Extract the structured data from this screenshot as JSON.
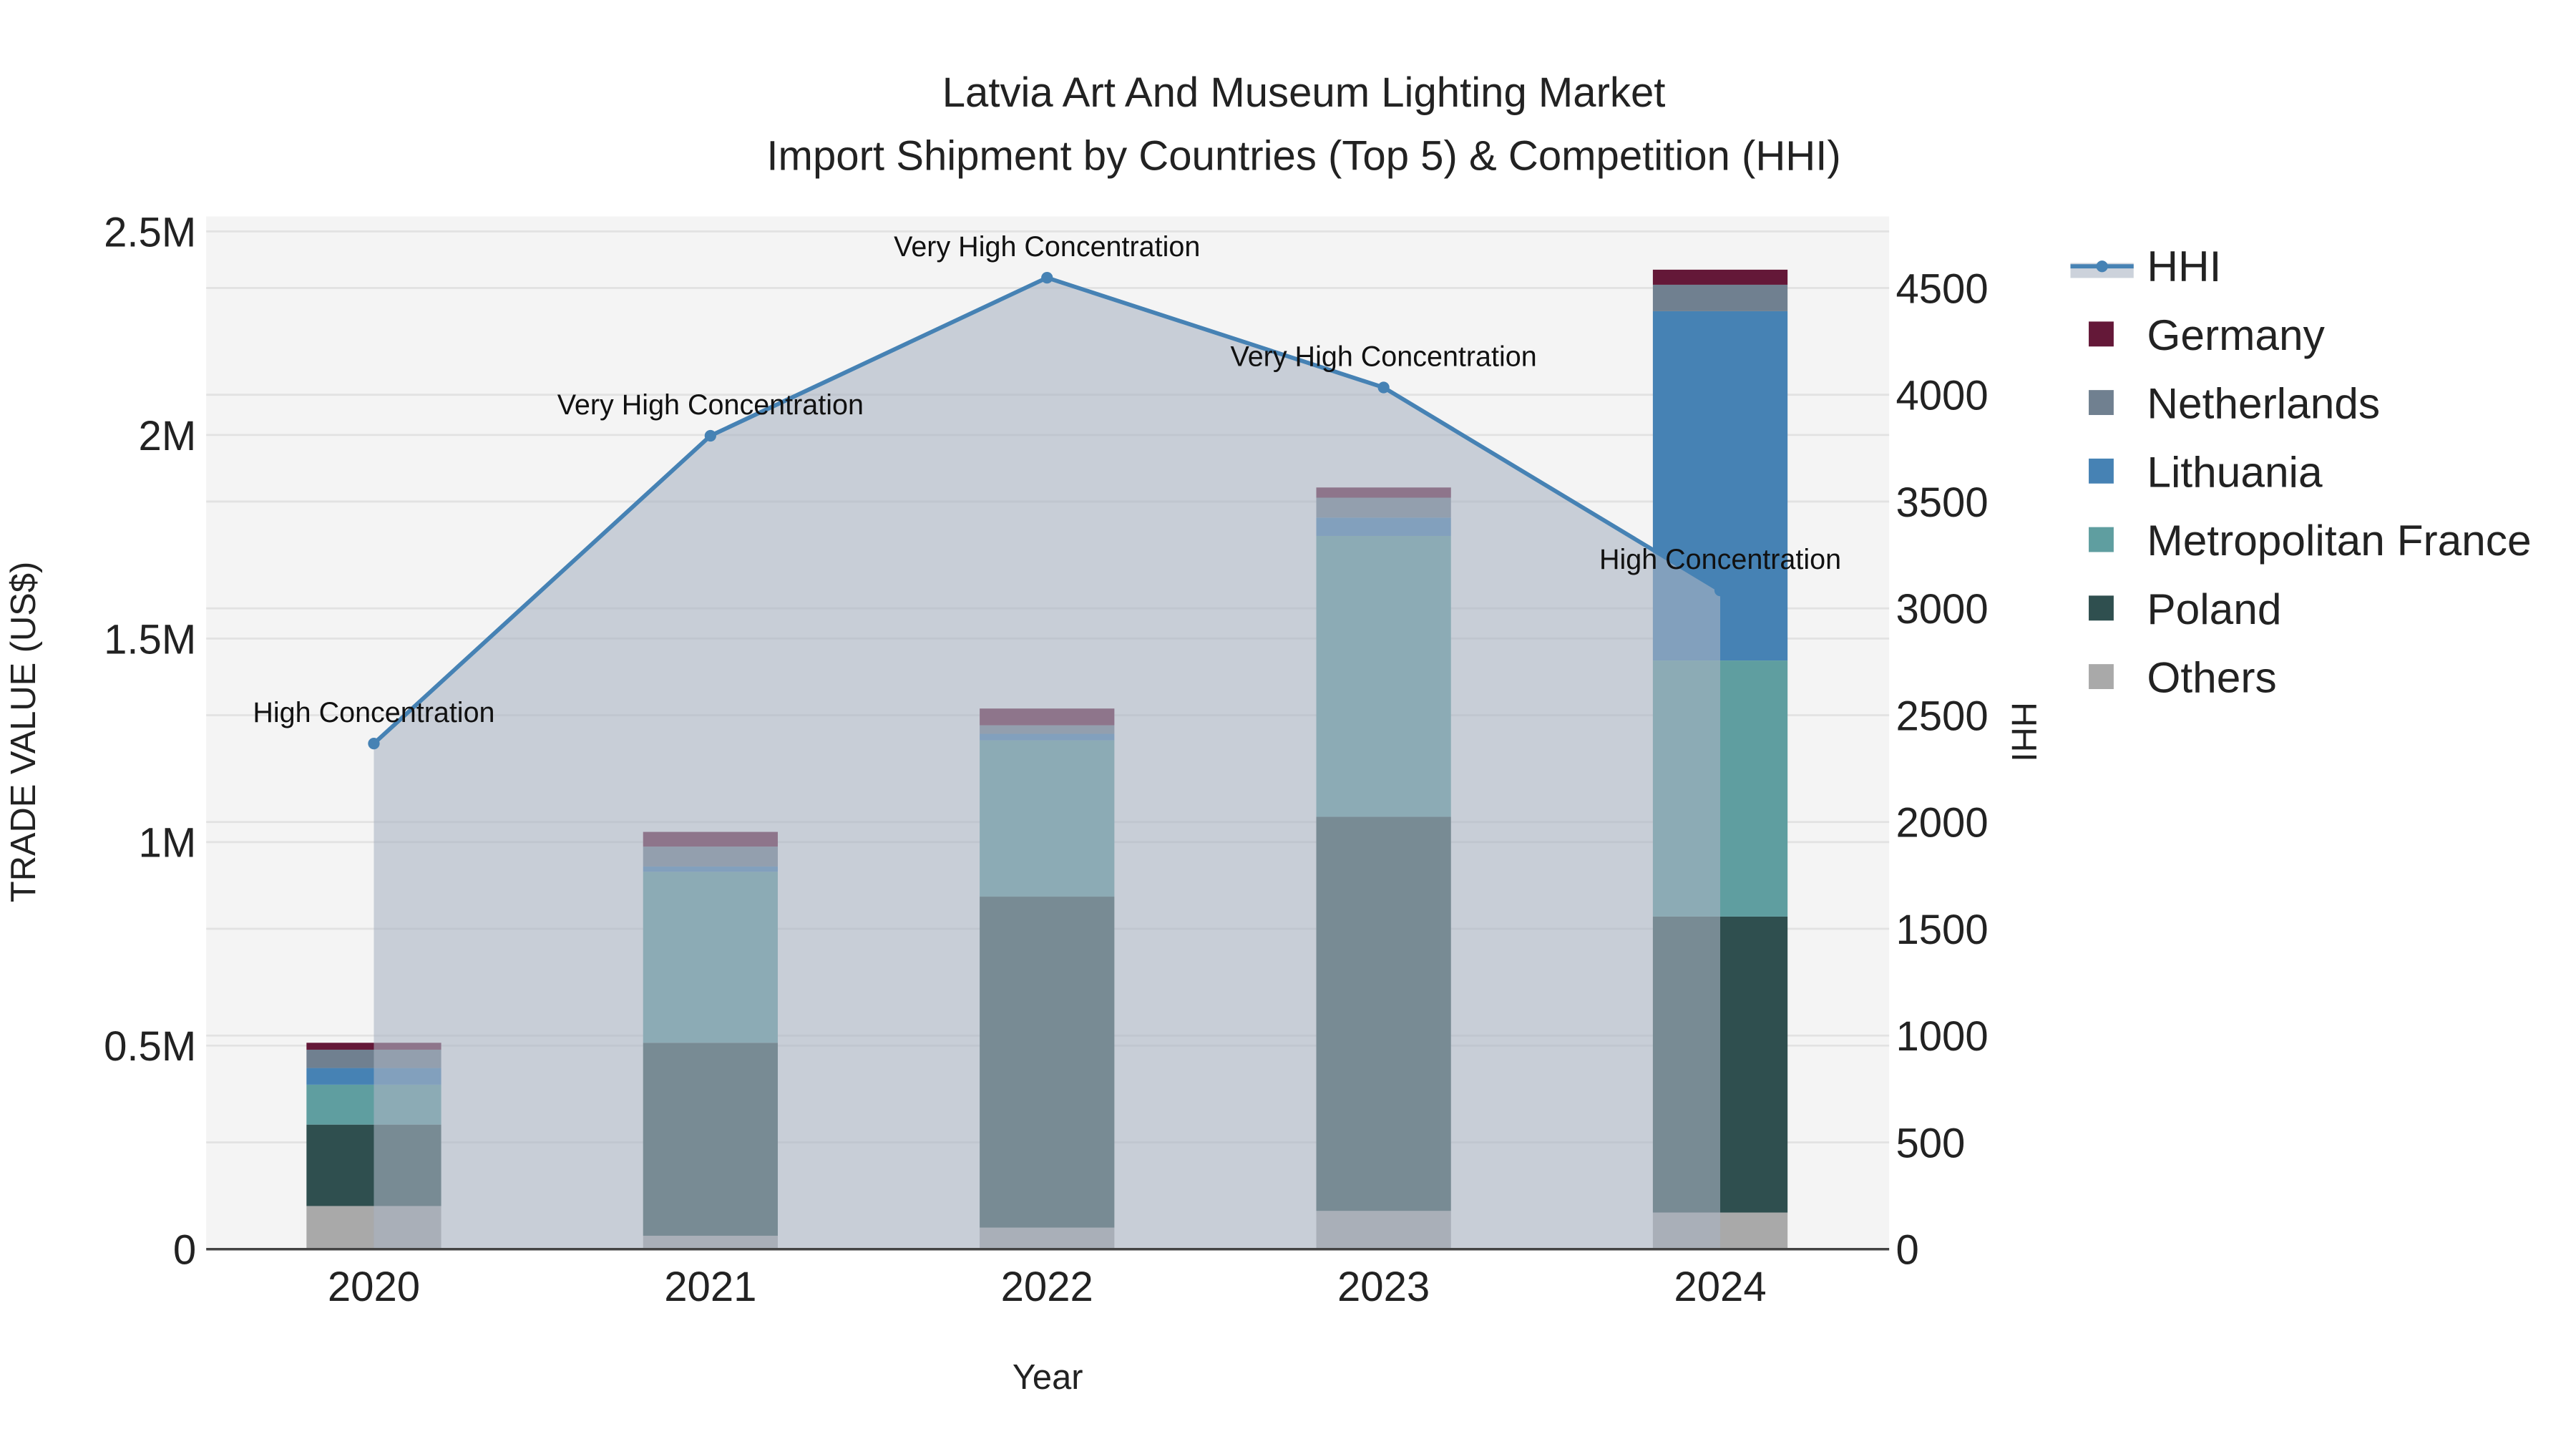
{
  "chart_data": {
    "type": "bar",
    "title": "Latvia Art And Museum Lighting Market",
    "subtitle": "Import Shipment by Countries (Top 5) & Competition (HHI)",
    "xlabel": "Year",
    "ylabel": "TRADE VALUE (US$)",
    "y2label": "HHI",
    "categories": [
      "2020",
      "2021",
      "2022",
      "2023",
      "2024"
    ],
    "ylim": [
      0,
      2500000
    ],
    "y2lim": [
      0,
      4800
    ],
    "yticks": [
      {
        "v": 0,
        "label": "0"
      },
      {
        "v": 500000,
        "label": "0.5M"
      },
      {
        "v": 1000000,
        "label": "1M"
      },
      {
        "v": 1500000,
        "label": "1.5M"
      },
      {
        "v": 2000000,
        "label": "2M"
      },
      {
        "v": 2500000,
        "label": "2.5M"
      }
    ],
    "y2ticks": [
      {
        "v": 0,
        "label": "0"
      },
      {
        "v": 500,
        "label": "500"
      },
      {
        "v": 1000,
        "label": "1000"
      },
      {
        "v": 1500,
        "label": "1500"
      },
      {
        "v": 2000,
        "label": "2000"
      },
      {
        "v": 2500,
        "label": "2500"
      },
      {
        "v": 3000,
        "label": "3000"
      },
      {
        "v": 3500,
        "label": "3500"
      },
      {
        "v": 4000,
        "label": "4000"
      },
      {
        "v": 4500,
        "label": "4500"
      }
    ],
    "series": [
      {
        "name": "Others",
        "color": "#a9a9a9",
        "values": [
          106000,
          33000,
          53000,
          94000,
          90000
        ]
      },
      {
        "name": "Poland",
        "color": "#2f4f4f",
        "values": [
          200000,
          474000,
          813000,
          968000,
          727000
        ]
      },
      {
        "name": "Metropolitan France",
        "color": "#5f9ea0",
        "values": [
          98000,
          420000,
          384000,
          690000,
          629000
        ]
      },
      {
        "name": "Lithuania",
        "color": "#4682b4",
        "values": [
          41000,
          13000,
          16000,
          45000,
          858000
        ]
      },
      {
        "name": "Netherlands",
        "color": "#708090",
        "values": [
          45000,
          49000,
          21000,
          49000,
          65000
        ]
      },
      {
        "name": "Germany",
        "color": "#641838",
        "values": [
          17000,
          36000,
          41000,
          25000,
          37000
        ]
      }
    ],
    "hhi": {
      "name": "HHI",
      "color": "#4682b4",
      "values": [
        2367,
        3808,
        4548,
        4034,
        3084
      ],
      "annotations": [
        "High Concentration",
        "Very High Concentration",
        "Very High Concentration",
        "Very High Concentration",
        "High Concentration"
      ]
    },
    "legend_order": [
      "HHI",
      "Germany",
      "Netherlands",
      "Lithuania",
      "Metropolitan France",
      "Poland",
      "Others"
    ],
    "legend_placement": "right",
    "grid": true
  }
}
